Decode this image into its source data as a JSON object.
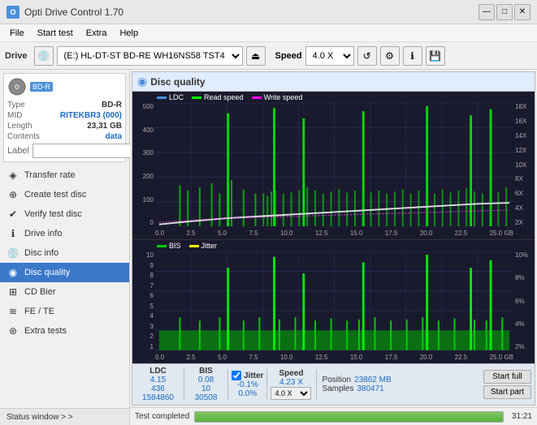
{
  "window": {
    "title": "Opti Drive Control 1.70",
    "icon": "O",
    "controls": {
      "minimize": "—",
      "maximize": "□",
      "close": "✕"
    }
  },
  "menu": {
    "items": [
      "File",
      "Start test",
      "Extra",
      "Help"
    ]
  },
  "toolbar": {
    "drive_label": "Drive",
    "drive_value": "(E:)  HL-DT-ST BD-RE  WH16NS58 TST4",
    "speed_label": "Speed",
    "speed_value": "4.0 X"
  },
  "disc": {
    "type": "BD-R",
    "rows": [
      {
        "label": "Type",
        "value": "BD-R"
      },
      {
        "label": "MID",
        "value": "RITEKBR3 (000)"
      },
      {
        "label": "Length",
        "value": "23,31 GB"
      },
      {
        "label": "Contents",
        "value": "data"
      },
      {
        "label": "Label",
        "value": ""
      }
    ]
  },
  "nav": {
    "items": [
      {
        "id": "transfer-rate",
        "label": "Transfer rate",
        "icon": "◈"
      },
      {
        "id": "create-test-disc",
        "label": "Create test disc",
        "icon": "⊕"
      },
      {
        "id": "verify-test-disc",
        "label": "Verify test disc",
        "icon": "✔"
      },
      {
        "id": "drive-info",
        "label": "Drive info",
        "icon": "ℹ"
      },
      {
        "id": "disc-info",
        "label": "Disc info",
        "icon": "💿"
      },
      {
        "id": "disc-quality",
        "label": "Disc quality",
        "icon": "◉",
        "active": true
      },
      {
        "id": "cd-bier",
        "label": "CD Bier",
        "icon": "⊞"
      },
      {
        "id": "fe-te",
        "label": "FE / TE",
        "icon": "≋"
      },
      {
        "id": "extra-tests",
        "label": "Extra tests",
        "icon": "⊛"
      }
    ]
  },
  "status_window": {
    "label": "Status window > >"
  },
  "disc_quality": {
    "title": "Disc quality",
    "legend": {
      "ldc": "LDC",
      "read_speed": "Read speed",
      "write_speed": "Write speed"
    },
    "top_chart": {
      "y_labels_left": [
        "0",
        "100",
        "200",
        "300",
        "400",
        "500"
      ],
      "y_labels_right": [
        "2X",
        "4X",
        "6X",
        "8X",
        "10X",
        "12X",
        "14X",
        "16X",
        "18X"
      ],
      "x_labels": [
        "0.0",
        "2.5",
        "5.0",
        "7.5",
        "10.0",
        "12.5",
        "15.0",
        "17.5",
        "20.0",
        "22.5",
        "25.0 GB"
      ]
    },
    "bottom_chart": {
      "legend": {
        "bis": "BIS",
        "jitter": "Jitter"
      },
      "y_labels_left": [
        "1",
        "2",
        "3",
        "4",
        "5",
        "6",
        "7",
        "8",
        "9",
        "10"
      ],
      "y_labels_right": [
        "2%",
        "4%",
        "6%",
        "8%",
        "10%"
      ],
      "x_labels": [
        "0.0",
        "2.5",
        "5.0",
        "7.5",
        "10.0",
        "12.5",
        "15.0",
        "17.5",
        "20.0",
        "22.5",
        "25.0 GB"
      ]
    },
    "stats": {
      "headers": [
        "LDC",
        "BIS",
        "",
        "Jitter",
        "Speed"
      ],
      "avg": {
        "ldc": "4.15",
        "bis": "0.08",
        "jitter": "-0.1%",
        "speed": "4.23 X"
      },
      "max": {
        "ldc": "436",
        "bis": "10",
        "jitter": "0.0%"
      },
      "total": {
        "ldc": "1584860",
        "bis": "30508"
      },
      "speed_select": "4.0 X",
      "position": {
        "label": "Position",
        "value": "23862 MB"
      },
      "samples": {
        "label": "Samples",
        "value": "380471"
      }
    },
    "buttons": {
      "start_full": "Start full",
      "start_part": "Start part"
    }
  },
  "bottom_status": {
    "text": "Test completed",
    "progress": 100,
    "time": "31:21"
  },
  "colors": {
    "accent_blue": "#3a78c9",
    "ldc_color": "#4a90e2",
    "read_speed_color": "#00ff00",
    "write_speed_color": "#ff00ff",
    "bis_color": "#00dd00",
    "jitter_color": "#ffff00",
    "chart_bg": "#1a1a2e",
    "grid_color": "#2a3060",
    "progress_green": "#6bc040"
  }
}
